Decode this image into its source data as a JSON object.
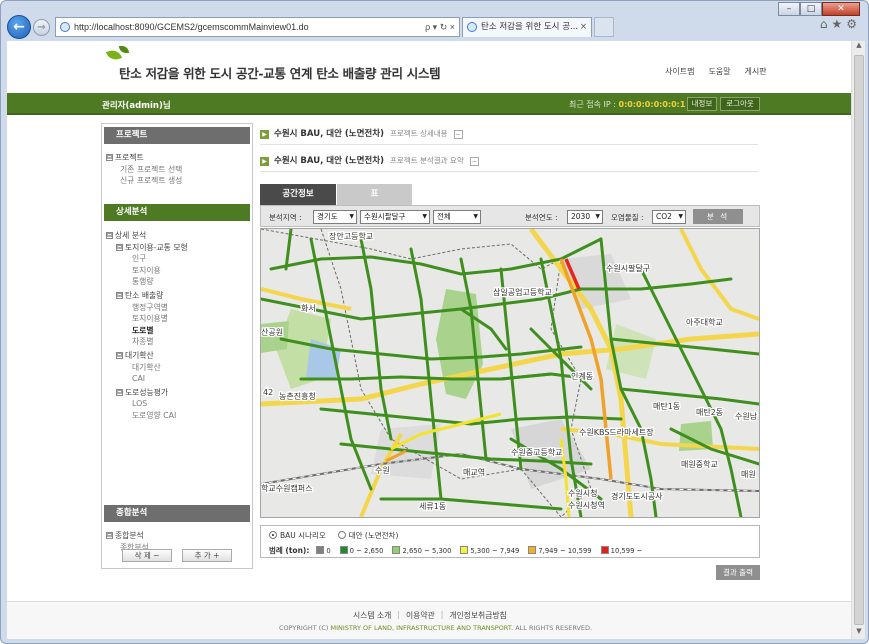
{
  "browser": {
    "url": "http://localhost:8090/GCEMS2/gcemscommMainview01.do",
    "tab_title": "탄소 저감을 위한 도시 공...",
    "tab_close": "×",
    "addr_tools": "ρ ▾ ↻ ×",
    "icons": [
      "home-icon",
      "star-icon",
      "gear-icon"
    ]
  },
  "header": {
    "title": "탄소 저감을 위한 도시 공간-교통 연계 탄소 배출량 관리 시스템",
    "links": [
      "사이트맵",
      "도움말",
      "게시판"
    ]
  },
  "userbar": {
    "user": "관리자(admin)님",
    "ip_label": "최근 접속 IP :",
    "ip": "0:0:0:0:0:0:0:1",
    "myinfo": "내정보",
    "logout": "로그아웃"
  },
  "sidebar": {
    "project_head": "프로젝트",
    "project_root": "프로젝트",
    "project_items": [
      "기존 프로젝트 선택",
      "신규 프로젝트 생성"
    ],
    "detail_head": "상세분석",
    "detail_root": "상세 분석",
    "group1": "토지이용-교통 모형",
    "group1_items": [
      "인구",
      "토지이용",
      "통행량"
    ],
    "group2": "탄소 배출량",
    "group2_items": [
      "행정구역별",
      "토지이용별",
      "도로별",
      "차종별"
    ],
    "group3": "대기확산",
    "group3_items": [
      "대기확산",
      "CAI"
    ],
    "group4": "도로성능평가",
    "group4_items": [
      "LOS",
      "도로영향 CAI"
    ],
    "summary_head": "종합분석",
    "summary_root": "종합분석",
    "summary_items": [
      "종합분석"
    ],
    "btn_delete": "삭 제  −",
    "btn_add": "추 가  +"
  },
  "projects": [
    {
      "name": "수원시 BAU, 대안 (노면전차)",
      "desc": "프로젝트 상세내용",
      "btn": "−"
    },
    {
      "name": "수원시 BAU, 대안 (노면전차)",
      "desc": "프로젝트 분석결과 요약",
      "btn": "−"
    }
  ],
  "tabs": [
    "공간정보",
    "표"
  ],
  "filters": {
    "region_label": "분석지역 :",
    "province": "경기도",
    "city": "수원시팔달구",
    "district": "전체",
    "year_label": "분석연도 :",
    "year": "2030",
    "pollutant_label": "오염물질 :",
    "pollutant": "CO2",
    "analyze": "분 석"
  },
  "map": {
    "labels": {
      "l1": "장안고등학교",
      "l2": "수원시팔달구",
      "l3": "아주대학교",
      "l4": "화서",
      "l5": "산공원",
      "l6": "농촌진흥청",
      "l7": "수원",
      "l8": "매교역",
      "l9": "세류1동",
      "l10": "학교수원캠퍼스",
      "l11": "매원중학교",
      "l12": "수원시청역",
      "l13": "수원시청",
      "l14": "매원",
      "l15": "수원남",
      "l16": "매탄1동",
      "l17": "매탄2동",
      "l18": "경기도도시공사",
      "l19": "인계동",
      "l20": "42",
      "l21": "수원KBS드라마세트장",
      "l22": "삼일공업고등학교",
      "l23": "수원중고등학교"
    },
    "colors": {
      "green": "#3f8f1f",
      "yellow": "#f3e32a",
      "orange": "#f0a12a",
      "red": "#e5261d"
    }
  },
  "legend": {
    "scenario_bau": "BAU 시나리오",
    "scenario_alt": "대안 (노면전차)",
    "label": "범례 (ton):",
    "items": [
      {
        "color": "#808080",
        "text": "0"
      },
      {
        "color": "#1e8c2c",
        "text": "0 ~ 2,650"
      },
      {
        "color": "#8ed06a",
        "text": "2,650 ~ 5,300"
      },
      {
        "color": "#f6f23a",
        "text": "5,300 ~ 7,949"
      },
      {
        "color": "#f3b02b",
        "text": "7,949 ~ 10,599"
      },
      {
        "color": "#e5201b",
        "text": "10,599 ~"
      }
    ]
  },
  "save_button": "결과 출력",
  "footer": {
    "links": [
      "시스템 소개",
      "이용약관",
      "개인정보취급방침"
    ],
    "copy_prefix": "COPYRIGHT (C)",
    "copy_org": "MINISTRY OF LAND, INFRASTRUCTURE AND TRANSPORT.",
    "copy_suffix": "ALL RIGHTS RESERVED."
  }
}
